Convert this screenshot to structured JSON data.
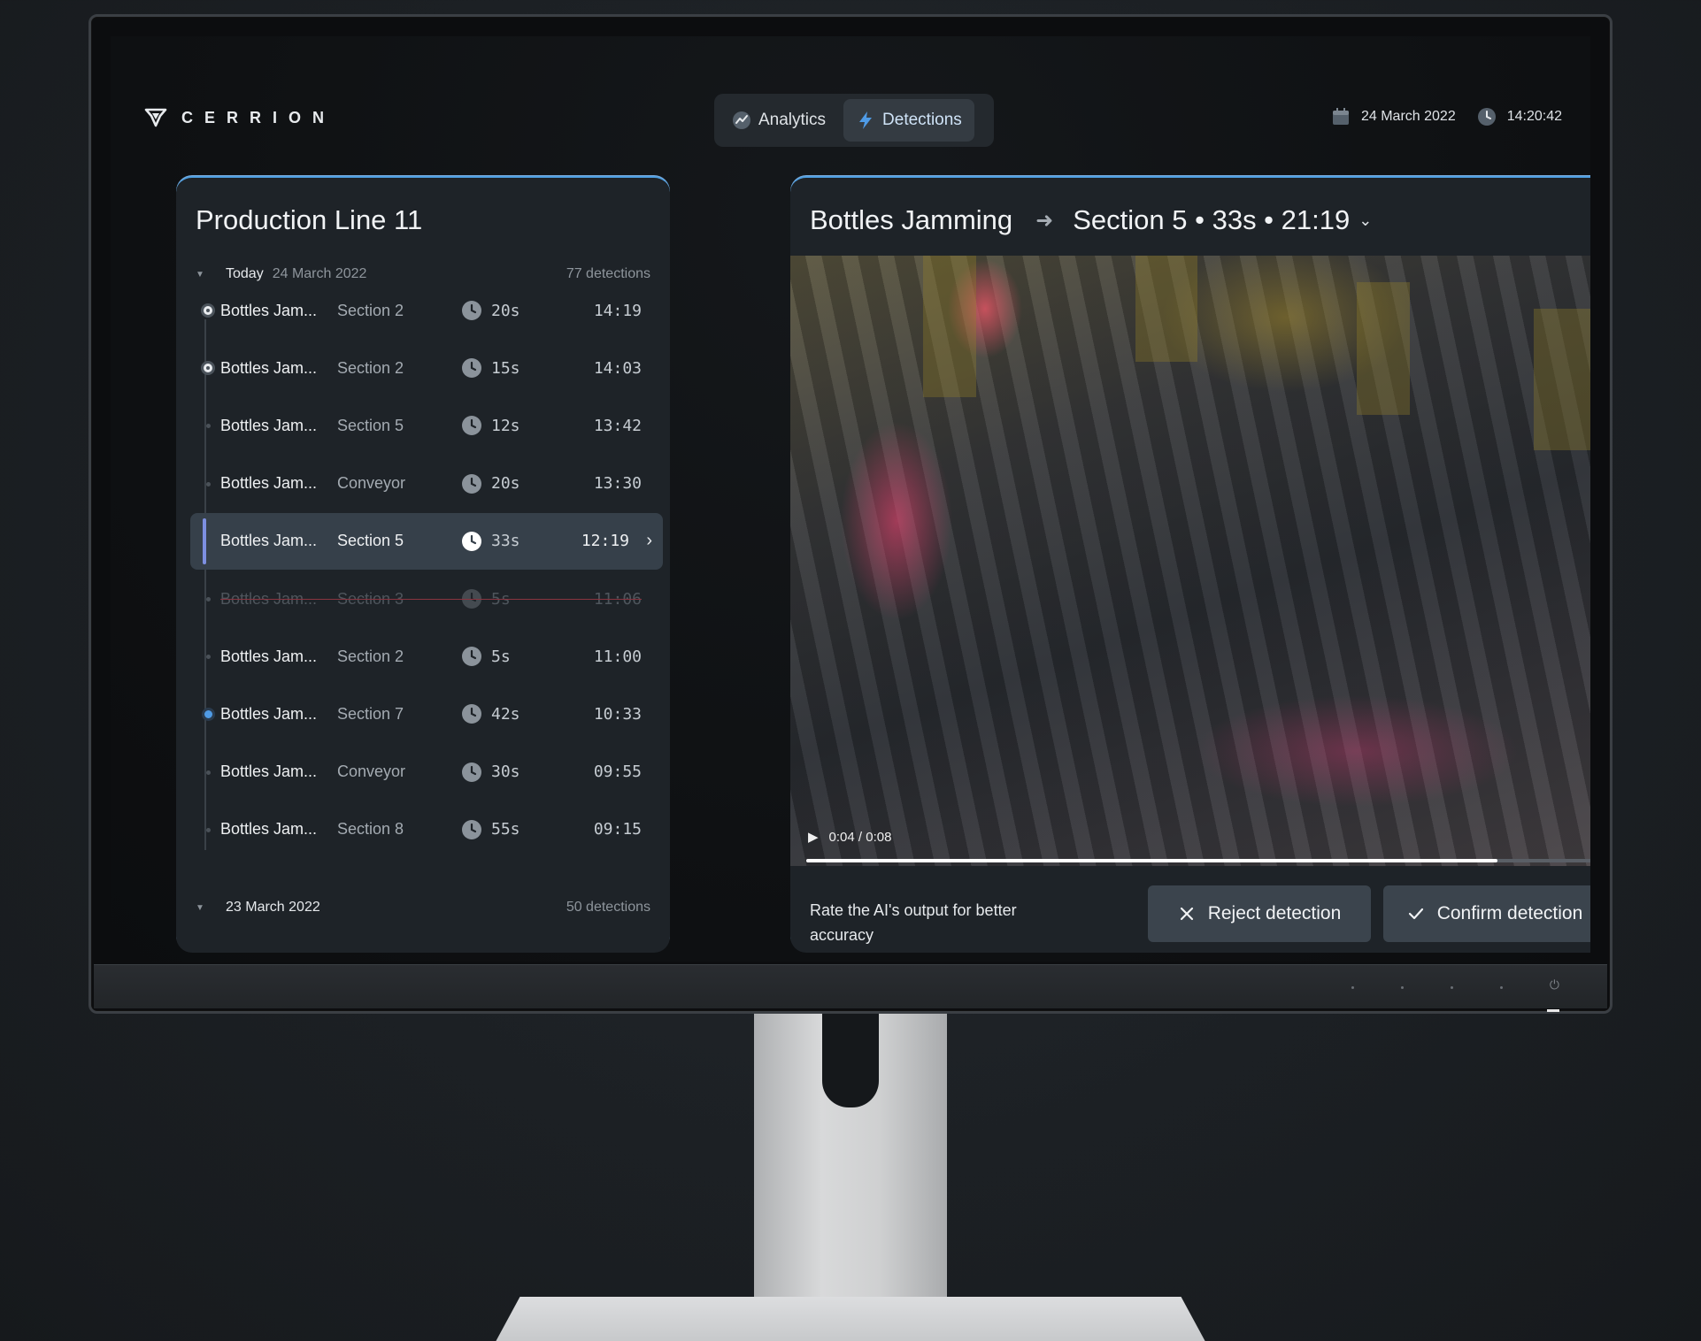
{
  "header": {
    "brand": "CERRION",
    "tabs": [
      {
        "label": "Analytics",
        "icon": "analytics-icon",
        "active": false
      },
      {
        "label": "Detections",
        "icon": "bolt-icon",
        "active": true
      }
    ],
    "date": "24 March 2022",
    "time": "14:20:42"
  },
  "left": {
    "title": "Production Line 11",
    "groups": [
      {
        "label": "Today",
        "date": "24 March 2022",
        "count": "77 detections"
      },
      {
        "label": "23 March 2022",
        "date": "",
        "count": "50 detections"
      }
    ],
    "rows": [
      {
        "name": "Bottles Jam...",
        "section": "Section 2",
        "duration": "20s",
        "time": "14:19",
        "marker": "ring"
      },
      {
        "name": "Bottles Jam...",
        "section": "Section 2",
        "duration": "15s",
        "time": "14:03",
        "marker": "ring"
      },
      {
        "name": "Bottles Jam...",
        "section": "Section 5",
        "duration": "12s",
        "time": "13:42",
        "marker": "small"
      },
      {
        "name": "Bottles Jam...",
        "section": "Conveyor",
        "duration": "20s",
        "time": "13:30",
        "marker": "small"
      },
      {
        "name": "Bottles Jam...",
        "section": "Section 5",
        "duration": "33s",
        "time": "12:19",
        "marker": "bar",
        "active": true
      },
      {
        "name": "Bottles Jam...",
        "section": "Section 3",
        "duration": "5s",
        "time": "11:06",
        "marker": "small",
        "rejected": true
      },
      {
        "name": "Bottles Jam...",
        "section": "Section 2",
        "duration": "5s",
        "time": "11:00",
        "marker": "small"
      },
      {
        "name": "Bottles Jam...",
        "section": "Section 7",
        "duration": "42s",
        "time": "10:33",
        "marker": "blue"
      },
      {
        "name": "Bottles Jam...",
        "section": "Conveyor",
        "duration": "30s",
        "time": "09:55",
        "marker": "small"
      },
      {
        "name": "Bottles Jam...",
        "section": "Section 8",
        "duration": "55s",
        "time": "09:15",
        "marker": "small"
      }
    ]
  },
  "detail": {
    "title": "Bottles Jamming",
    "subtitle": "Section 5 • 33s • 21:19",
    "video": {
      "position": "0:04 / 0:08",
      "progress": 0.86
    },
    "rate_text": "Rate the AI's output for better accuracy",
    "reject_label": "Reject detection",
    "confirm_label": "Confirm detection"
  },
  "colors": {
    "accent": "#4f9be6",
    "active_row": "#36404a",
    "reject_strike": "#8a3440"
  }
}
